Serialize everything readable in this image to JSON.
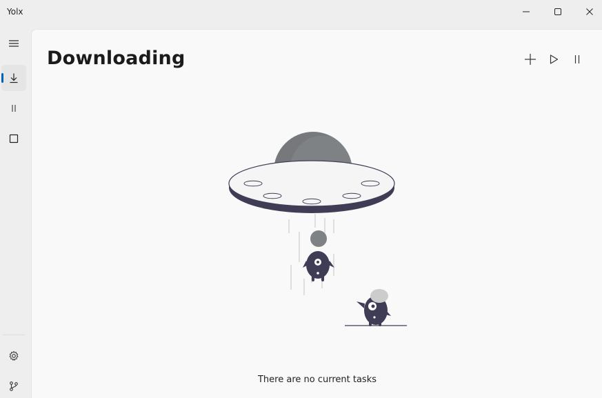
{
  "window": {
    "title": "Yolx",
    "controls": [
      "minimize-icon",
      "maximize-icon",
      "close-icon"
    ]
  },
  "sidebar": {
    "items": [
      {
        "name": "hamburger-menu",
        "icon": "hamburger-icon",
        "selected": false
      },
      {
        "name": "downloading",
        "icon": "download-icon",
        "selected": true
      },
      {
        "name": "paused",
        "icon": "pause-icon",
        "selected": false
      },
      {
        "name": "stopped",
        "icon": "stop-icon",
        "selected": false
      }
    ],
    "footer": [
      {
        "name": "settings",
        "icon": "gear-icon"
      },
      {
        "name": "source-control",
        "icon": "branch-icon"
      }
    ]
  },
  "page": {
    "title": "Downloading",
    "actions": [
      "add-icon",
      "play-icon",
      "pause-icon"
    ],
    "empty_message": "There are no current tasks"
  },
  "colors": {
    "accent": "#005fb8",
    "illustration_dark": "#3f3d56",
    "illustration_gray": "#7f8285",
    "illustration_light_gray": "#cccccc"
  }
}
